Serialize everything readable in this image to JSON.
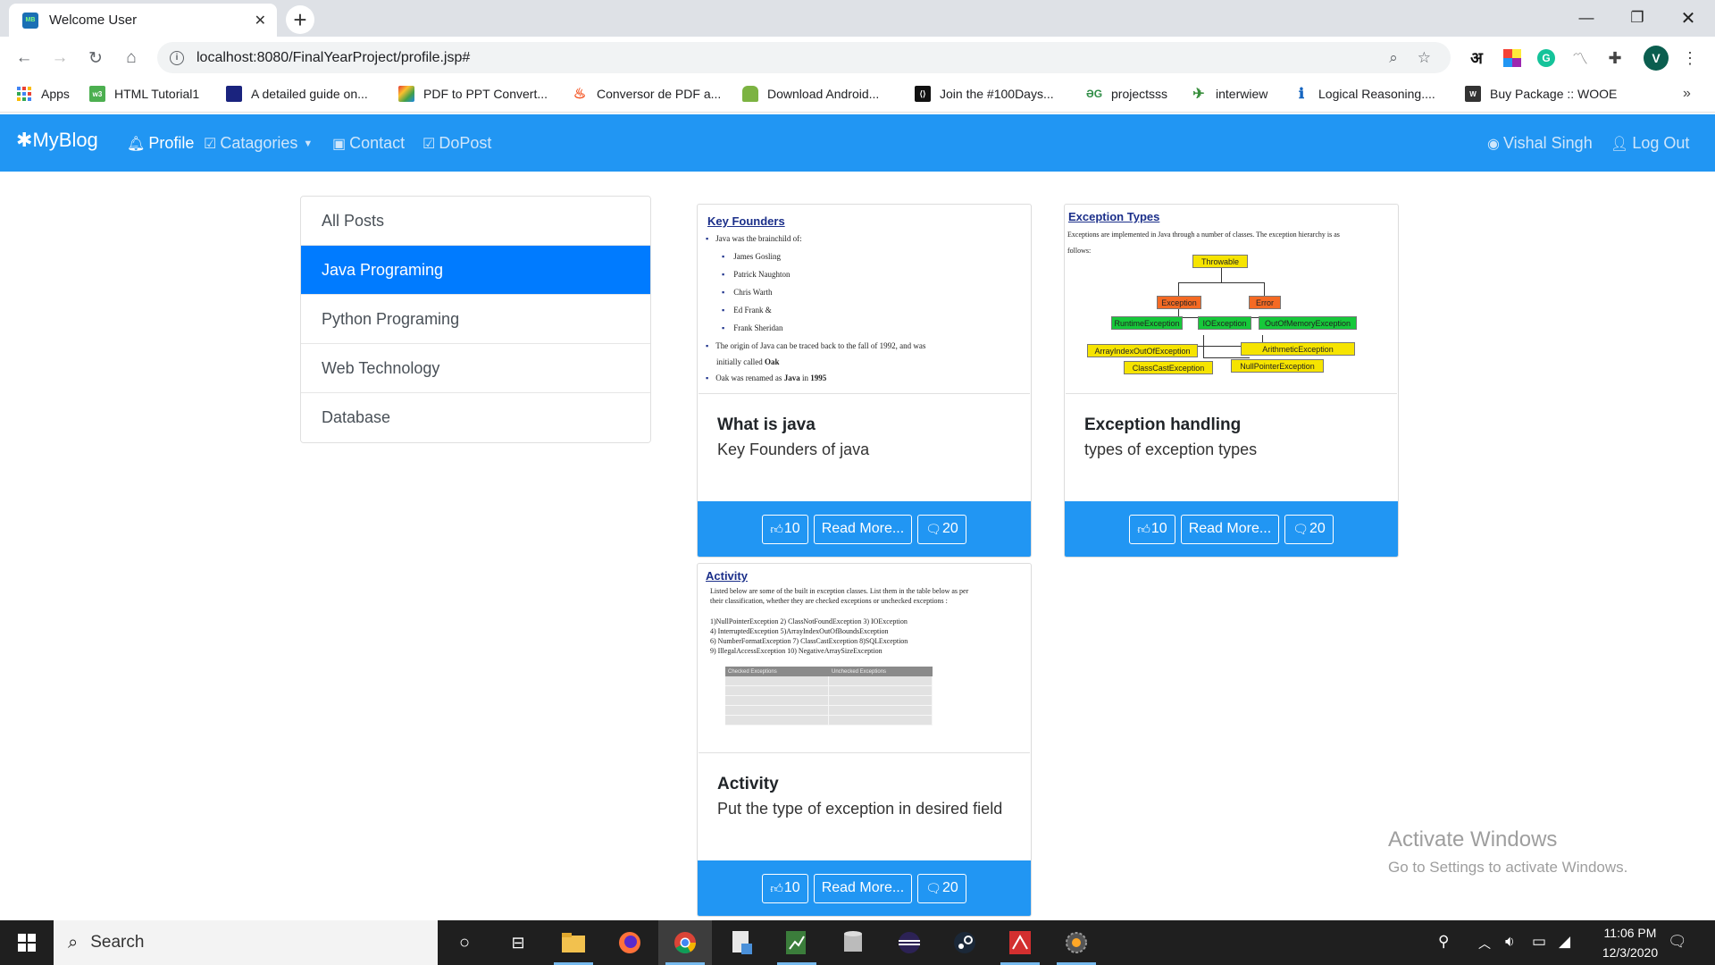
{
  "browser": {
    "tab_title": "Welcome User",
    "tab_favicon_text": "MB",
    "url": "localhost:8080/FinalYearProject/profile.jsp#",
    "profile_initial": "V",
    "translate_glyph": "अ"
  },
  "bookmarks": [
    {
      "label": "Apps",
      "icon": "apps-grid-icon",
      "color": "#4285f4"
    },
    {
      "label": "HTML Tutorial1",
      "icon": "w3-icon",
      "color": "#4caf50"
    },
    {
      "label": "A detailed guide on...",
      "icon": "dark-guide-icon",
      "color": "#1a237e"
    },
    {
      "label": "PDF to PPT Convert...",
      "icon": "pdf-ppt-icon",
      "color": "#e53935"
    },
    {
      "label": "Conversor de PDF a...",
      "icon": "pdf-flame-icon",
      "color": "#f4511e"
    },
    {
      "label": "Download Android...",
      "icon": "android-icon",
      "color": "#7cb342"
    },
    {
      "label": "Join the #100Days...",
      "icon": "devto-icon",
      "color": "#111111"
    },
    {
      "label": "projectsss",
      "icon": "gfg-icon",
      "color": "#2f8d46"
    },
    {
      "label": "interwiew",
      "icon": "interview-icon",
      "color": "#388e3c"
    },
    {
      "label": "Logical Reasoning....",
      "icon": "logical-icon",
      "color": "#1565c0"
    },
    {
      "label": "Buy Package :: WOOE",
      "icon": "wooe-icon",
      "color": "#333333"
    }
  ],
  "navbar": {
    "brand": "MyBlog",
    "profile": "Profile",
    "categories": "Catagories",
    "contact": "Contact",
    "dopost": "DoPost",
    "user": "Vishal Singh",
    "logout": "Log Out"
  },
  "sidebar": {
    "items": [
      {
        "label": "All Posts",
        "active": false
      },
      {
        "label": "Java Programing",
        "active": true
      },
      {
        "label": "Python Programing",
        "active": false
      },
      {
        "label": "Web Technology",
        "active": false
      },
      {
        "label": "Database",
        "active": false
      }
    ]
  },
  "posts": [
    {
      "title": "What is java",
      "description": "Key Founders of java",
      "likes": "10",
      "read_more": "Read More...",
      "comments": "20",
      "thumb": {
        "heading": "Key Founders",
        "lines": [
          "Java was the brainchild of:",
          "James Gosling",
          "Patrick Naughton",
          "Chris Warth",
          "Ed Frank &",
          "Frank Sheridan",
          "The origin of Java can be traced back to the fall of 1992, and was",
          "initially  called",
          "Oak",
          "Oak was renamed as",
          "Java",
          "in",
          "1995"
        ]
      }
    },
    {
      "title": "Exception handling",
      "description": "types of exception types",
      "likes": "10",
      "read_more": "Read More...",
      "comments": "20",
      "thumb": {
        "heading": "Exception Types",
        "intro_1": "Exceptions are implemented in Java through a number of classes.  The exception hierarchy is as",
        "intro_2": "follows:",
        "nodes": [
          "Throwable",
          "Exception",
          "Error",
          "RuntimeException",
          "IOException",
          "OutOfMemoryException",
          "ArrayIndexOutOfException",
          "ArithmeticException",
          "ClassCastException",
          "NullPointerException"
        ]
      }
    },
    {
      "title": "Activity",
      "description": "Put the type of exception in desired field",
      "likes": "10",
      "read_more": "Read More...",
      "comments": "20",
      "thumb": {
        "heading": "Activity",
        "lines": [
          "Listed below are some of the built in exception classes.  List them in the table below as per",
          "their classification, whether they are checked exceptions or unchecked exceptions :",
          "1)NullPointerException 2) ClassNotFoundException 3) IOException",
          "4) InterruptedException 5)ArrayIndexOutOfBoundsException",
          "6) NumberFormatException 7)  ClassCastException 8)SQLException",
          "9) IllegalAccessException 10) NegativeArraySizeException"
        ],
        "table_headers": [
          "Checked Exceptions",
          "Unchecked Exceptions"
        ]
      }
    }
  ],
  "watermark": {
    "line1": "Activate Windows",
    "line2": "Go to Settings to activate Windows."
  },
  "taskbar": {
    "search_placeholder": "Search",
    "time": "11:06 PM",
    "date": "12/3/2020"
  }
}
